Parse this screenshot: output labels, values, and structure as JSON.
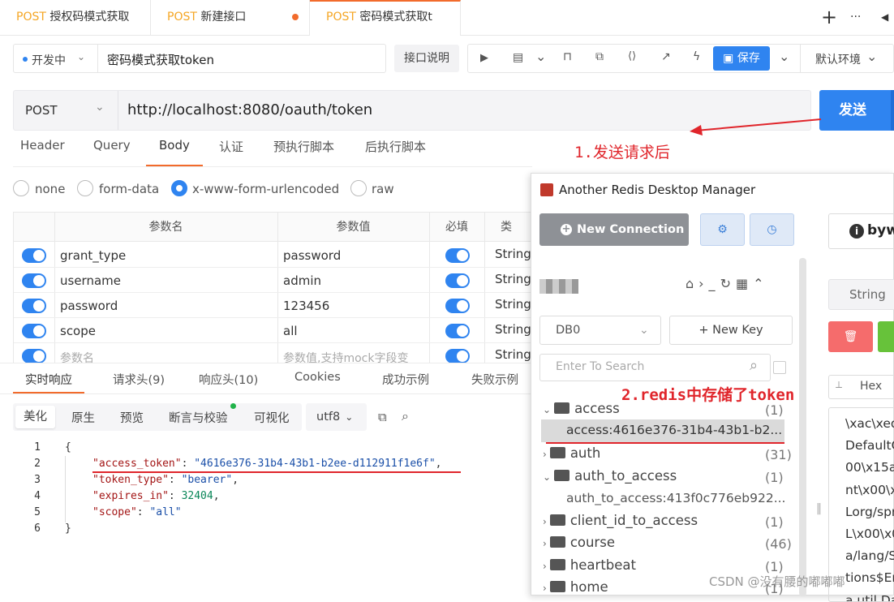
{
  "tabs": [
    {
      "method": "POST",
      "name": "授权码模式获取"
    },
    {
      "method": "POST",
      "name": "新建接口"
    },
    {
      "method": "POST",
      "name": "密码模式获取t"
    }
  ],
  "toolbar": {
    "plus": "+",
    "more": "···",
    "env": "开发中",
    "api_name": "密码模式获取token",
    "doc_btn": "接口说明",
    "save": "保存",
    "env_select": "默认环境"
  },
  "request": {
    "method": "POST",
    "url": "http://localhost:8080/oauth/token",
    "send": "发送"
  },
  "req_tabs": [
    "Header",
    "Query",
    "Body",
    "认证",
    "预执行脚本",
    "后执行脚本"
  ],
  "body_types": [
    "none",
    "form-data",
    "x-www-form-urlencoded",
    "raw"
  ],
  "table": {
    "headers": [
      "参数名",
      "参数值",
      "必填",
      "类"
    ],
    "rows": [
      {
        "name": "grant_type",
        "value": "password",
        "type": "String"
      },
      {
        "name": "username",
        "value": "admin",
        "type": "String"
      },
      {
        "name": "password",
        "value": "123456",
        "type": "String"
      },
      {
        "name": "scope",
        "value": "all",
        "type": "String"
      },
      {
        "name": "参数名",
        "value": "参数值,支持mock字段变",
        "type": "String"
      }
    ]
  },
  "resp_tabs": [
    "实时响应",
    "请求头(9)",
    "响应头(10)",
    "Cookies",
    "成功示例",
    "失败示例"
  ],
  "view_tabs": [
    "美化",
    "原生",
    "预览",
    "断言与校验",
    "可视化"
  ],
  "encoding": "utf8",
  "code": {
    "open": "{",
    "close": "}",
    "lines": [
      "1",
      "2",
      "3",
      "4",
      "5",
      "6"
    ],
    "k1": "\"access_token\"",
    "v1": "\"4616e376-31b4-43b1-b2ee-d112911f1e6f\"",
    "k2": "\"token_type\"",
    "v2": "\"bearer\"",
    "k3": "\"expires_in\"",
    "v3": "32404",
    "k4": "\"scope\"",
    "v4": "\"all\""
  },
  "redis": {
    "title": "Another Redis Desktop Manager",
    "new_connection": "New Connection",
    "db": "DB0",
    "new_key": "New Key",
    "search_placeholder": "Enter To Search",
    "tree": [
      {
        "label": "access",
        "count": "(1)",
        "kind": "folder-open"
      },
      {
        "label": "access:4616e376-31b4-43b1-b2...",
        "count": "",
        "kind": "key-selected"
      },
      {
        "label": "auth",
        "count": "(31)",
        "kind": "folder"
      },
      {
        "label": "auth_to_access",
        "count": "(1)",
        "kind": "folder-open"
      },
      {
        "label": "auth_to_access:413f0c776eb922...",
        "count": "",
        "kind": "key"
      },
      {
        "label": "client_id_to_access",
        "count": "(1)",
        "kind": "folder"
      },
      {
        "label": "course",
        "count": "(46)",
        "kind": "folder"
      },
      {
        "label": "heartbeat",
        "count": "(1)",
        "kind": "folder"
      },
      {
        "label": "home",
        "count": "(1)",
        "kind": "folder"
      }
    ],
    "right": {
      "name": "byw",
      "type": "String",
      "format": "Hex",
      "lines": [
        "\\xac\\xed",
        "DefaultO",
        "00\\x15a",
        "nt\\x00\\x",
        "Lorg/spr",
        "L\\x00\\x0",
        "a/lang/S",
        "tions$Er",
        "a.util.Da"
      ]
    }
  },
  "annotations": {
    "a1": "1.发送请求后",
    "a2": "2.redis中存储了token"
  },
  "watermark": "CSDN @没有腰的嘟嘟嘟",
  "colors": {
    "accent": "#2f84f0",
    "tab_active": "#f26b2c",
    "annotation": "#e0252b",
    "method": "#f5a623"
  }
}
